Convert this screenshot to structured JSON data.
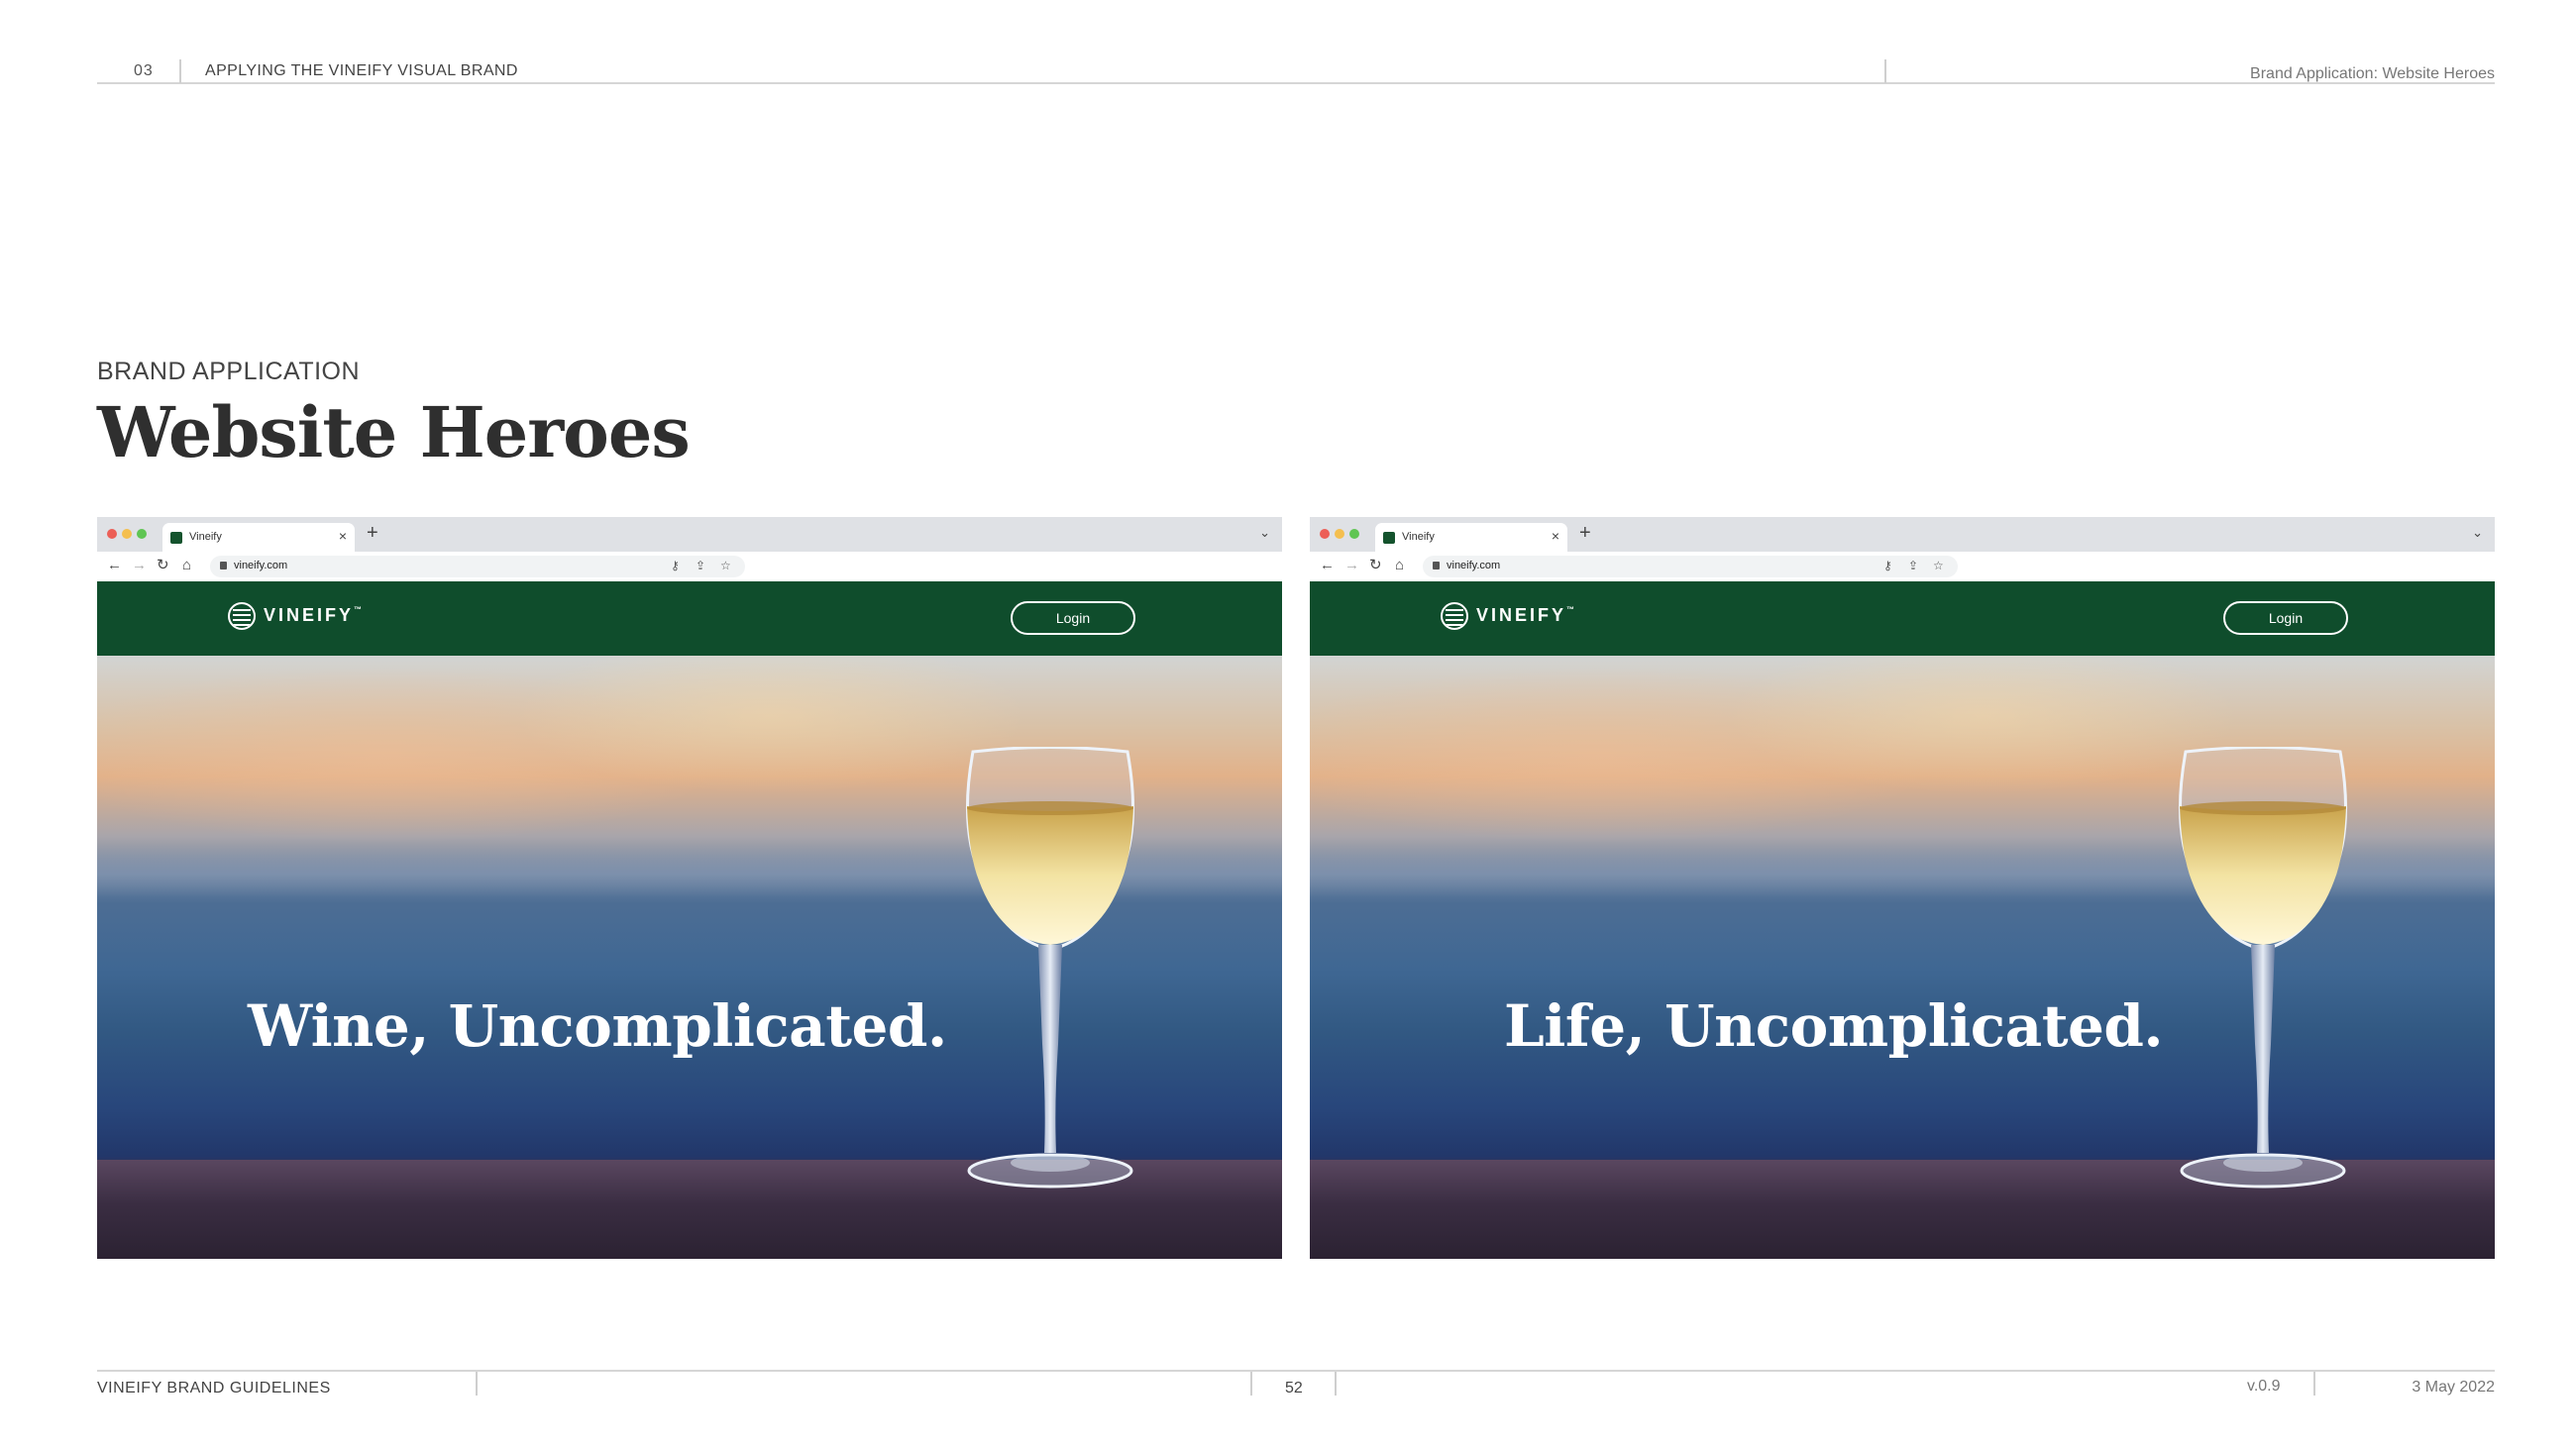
{
  "header": {
    "section_number": "03",
    "section_title": "APPLYING THE VINEIFY VISUAL BRAND",
    "page_topic": "Brand Application: Website Heroes"
  },
  "eyebrow": "BRAND APPLICATION",
  "title": "Website Heroes",
  "mockups": [
    {
      "tab_label": "Vineify",
      "url": "vineify.com",
      "logo": "VINEIFY",
      "logo_tm": "™",
      "login": "Login",
      "headline": "Wine, Uncomplicated."
    },
    {
      "tab_label": "Vineify",
      "url": "vineify.com",
      "logo": "VINEIFY",
      "logo_tm": "™",
      "login": "Login",
      "headline": "Life, Uncomplicated."
    }
  ],
  "footer": {
    "guide_name": "VINEIFY BRAND GUIDELINES",
    "page_number": "52",
    "version": "v.0.9",
    "date": "3 May 2022"
  },
  "colors": {
    "brand_green": "#0f4d2c",
    "text_dark": "#2f2f2f"
  }
}
